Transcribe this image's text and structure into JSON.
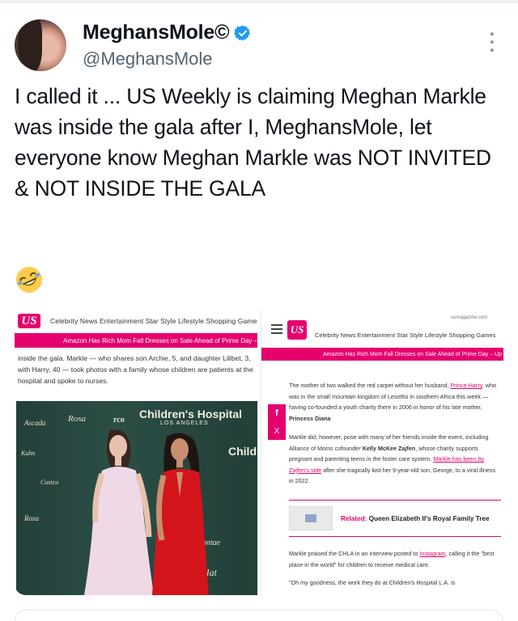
{
  "colors": {
    "accent": "#1d9bf0",
    "us_weekly_pink": "#e5006d",
    "muted_text": "#536471"
  },
  "tweet": {
    "display_name": "MeghansMole©",
    "verified_icon": "verified-badge-icon",
    "handle": "@MeghansMole",
    "text": "I called it ... US Weekly is claiming Meghan Markle was inside the gala after I, MeghansMole, let everyone know Meghan Markle was NOT INVITED & NOT INSIDE THE GALA",
    "emoji": "🤣"
  },
  "screenshot_left": {
    "logo": "US",
    "nav": "Celebrity News   Entertainment   Star Style   Lifestyle   Shopping   Games",
    "banner": "Amazon Has Rich Mom Fall Dresses on Sale Ahead of Prime Day – U",
    "paragraph": "inside the gala. Markle — who shares son Archie, 5, and daughter Lilibet, 3, with Harry, 40 — took photos with a family whose children are patients at the hospital and spoke to nurses.",
    "photo": {
      "sign_title": "Children's Hospital",
      "sign_sub": "LOS ANGELES",
      "sign_child": "Child"
    }
  },
  "screenshot_right": {
    "url": "usmagazine.com",
    "logo": "US",
    "nav": "Celebrity News   Entertainment   Star Style   Lifestyle   Shopping   Games",
    "banner": "Amazon Has Rich Mom Fall Dresses on Sale Ahead of Prime Day – Up",
    "share_facebook": "f",
    "share_x": "X",
    "para1": {
      "a": "The mother of two walked the red carpet without her husband, ",
      "link1": "Prince Harry",
      "b": ", who was in the small mountain kingdom of Lesotho in southern Africa this week — having co-founded a youth charity there in 2006 in honor of his late mother, ",
      "bold": "Princess Diana"
    },
    "para2": {
      "a": "Markle did, however, pose with many of her friends inside the event, including Alliance of Moms cofounder ",
      "bold": "Kelly McKee Zajfen",
      "b": ", whose charity supports pregnant and parenting teens in the foster care system. ",
      "link": "Markle has been by Zajfen's side",
      "c": " after she tragically lost her 9-year-old son, George, to a viral illness in 2022."
    },
    "related": {
      "label": "Related:",
      "title": "Queen Elizabeth II's Royal Family Tree"
    },
    "para3": {
      "a": "Markle praised the CHLA in an interview posted to ",
      "link": "Instagram",
      "b": ", calling it the \"best place in the world\" for children to receive medical care."
    },
    "para4": "\"Oh my goodness, the work they do at Children's Hospital L.A. is"
  }
}
